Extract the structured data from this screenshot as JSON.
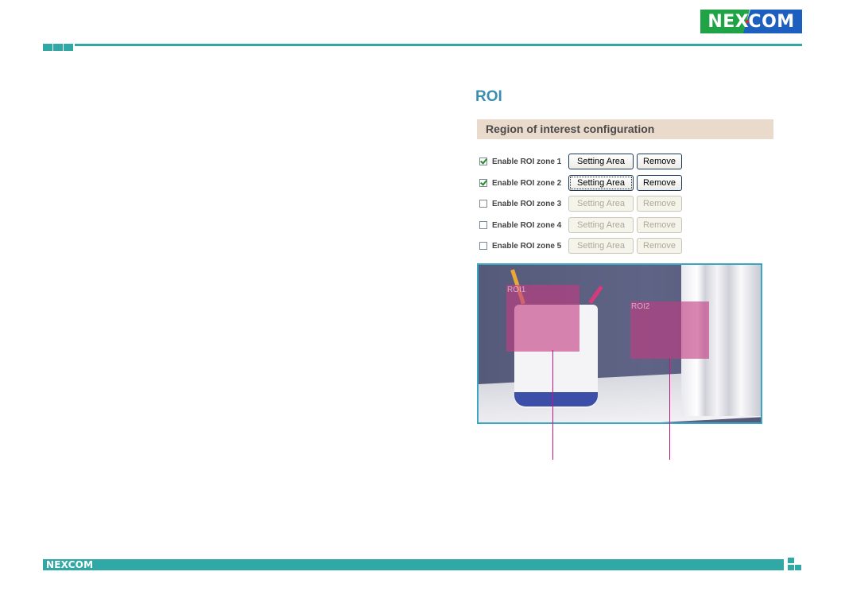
{
  "header": {
    "logo_text": "NEXCOM",
    "brand_colors": {
      "green": "#1fa346",
      "blue": "#1d5fbf",
      "accent_teal": "#2fa8a6"
    }
  },
  "section": {
    "title": "ROI",
    "config_header": "Region of interest configuration"
  },
  "zones": [
    {
      "label": "Enable ROI zone 1",
      "checked": true,
      "setting_label": "Setting Area",
      "remove_label": "Remove",
      "enabled": true
    },
    {
      "label": "Enable ROI zone 2",
      "checked": true,
      "setting_label": "Setting Area",
      "remove_label": "Remove",
      "enabled": true
    },
    {
      "label": "Enable ROI zone 3",
      "checked": false,
      "setting_label": "Setting Area",
      "remove_label": "Remove",
      "enabled": false
    },
    {
      "label": "Enable ROI zone 4",
      "checked": false,
      "setting_label": "Setting Area",
      "remove_label": "Remove",
      "enabled": false
    },
    {
      "label": "Enable ROI zone 5",
      "checked": false,
      "setting_label": "Setting Area",
      "remove_label": "Remove",
      "enabled": false
    }
  ],
  "preview": {
    "roi_labels": [
      "ROI1",
      "ROI2"
    ],
    "roi_color": "#c43c82"
  },
  "footer": {
    "logo_text": "NEXCOM"
  }
}
